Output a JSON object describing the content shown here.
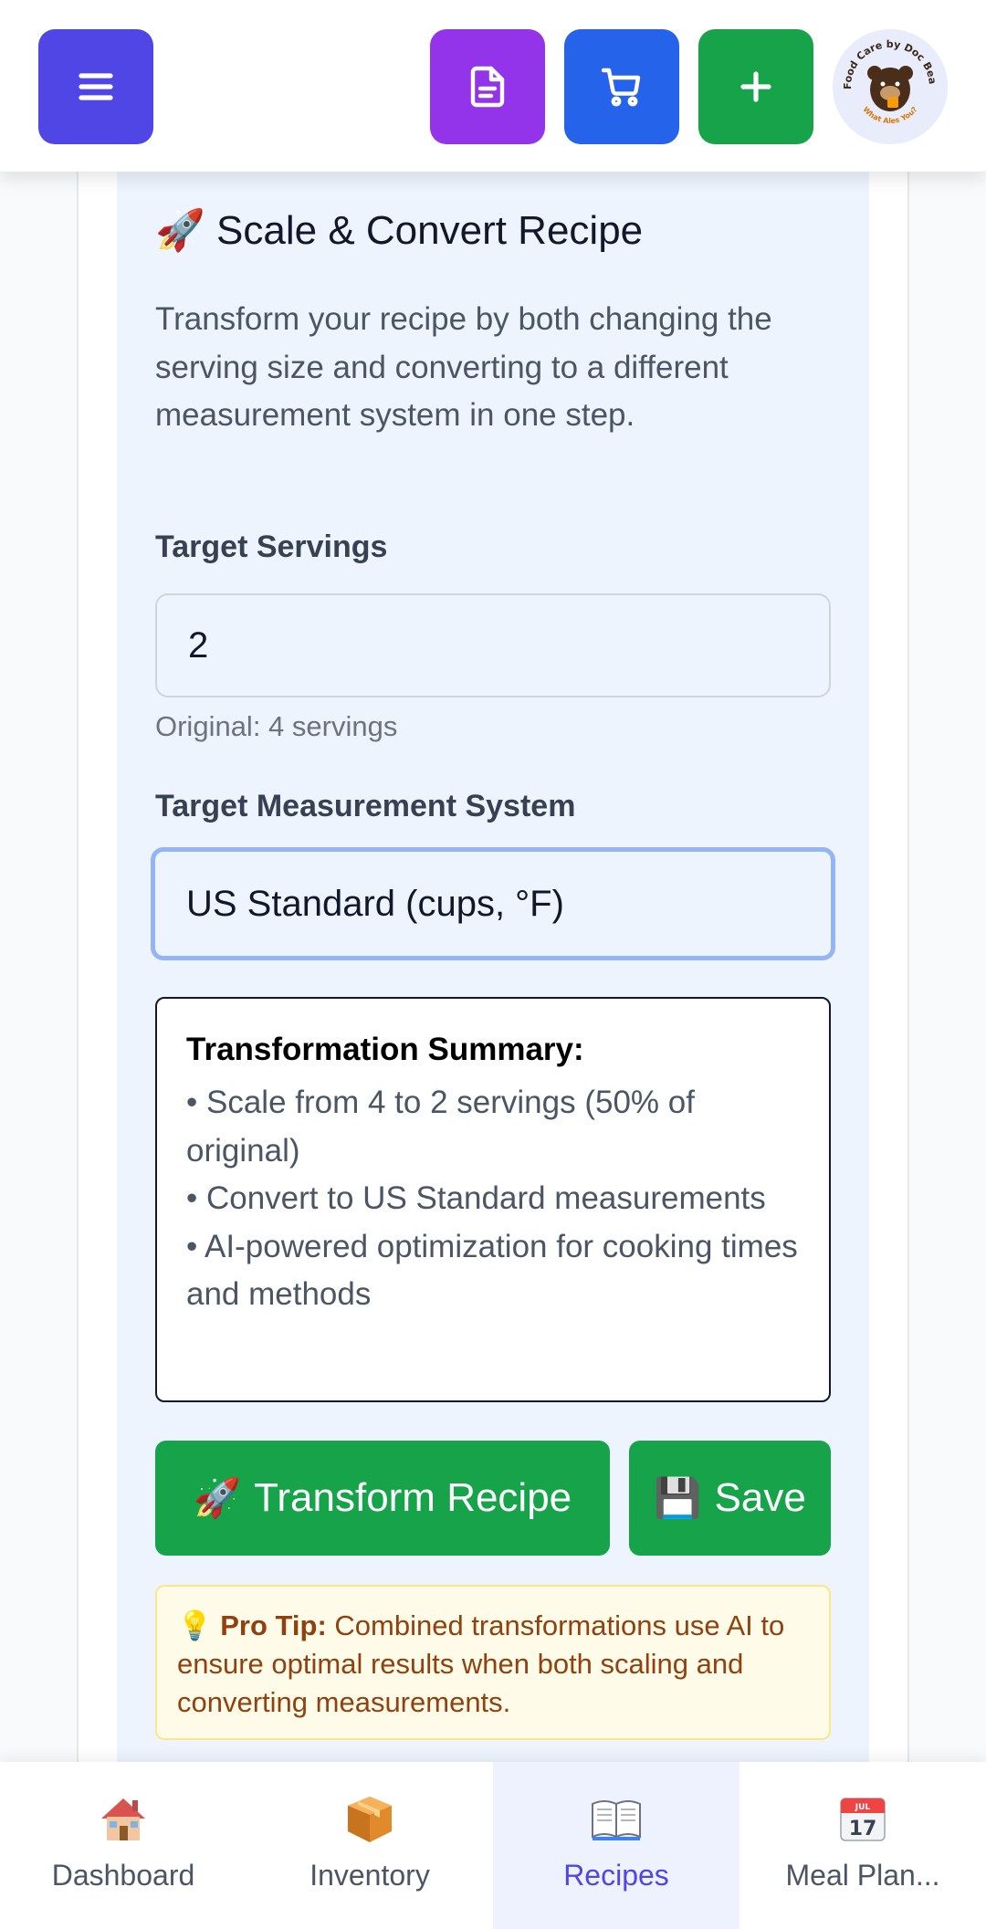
{
  "header": {
    "menu_icon": "hamburger-icon",
    "buttons": [
      {
        "name": "document",
        "icon": "document-icon",
        "color": "#9333ea"
      },
      {
        "name": "cart",
        "icon": "cart-icon",
        "color": "#2563eb"
      },
      {
        "name": "add",
        "icon": "plus-icon",
        "color": "#16a34a"
      }
    ],
    "logo_text_top": "Food Care by Doc Bear",
    "logo_text_bottom": "What Ales You?"
  },
  "section": {
    "title_emoji": "🚀",
    "title": "Scale & Convert Recipe",
    "description": "Transform your recipe by both changing the serving size and converting to a different measurement system in one step."
  },
  "form": {
    "servings_label": "Target Servings",
    "servings_value": "2",
    "servings_hint": "Original: 4 servings",
    "system_label": "Target Measurement System",
    "system_value": "US Standard (cups, °F)"
  },
  "summary": {
    "title": "Transformation Summary:",
    "items": [
      "• Scale from 4 to 2 servings (50% of original)",
      "• Convert to US Standard measurements",
      "• AI-powered optimization for cooking times and methods"
    ]
  },
  "actions": {
    "transform_emoji": "🚀",
    "transform_label": "Transform Recipe",
    "save_emoji": "💾",
    "save_label": "Save"
  },
  "tip": {
    "emoji": "💡",
    "label": "Pro Tip:",
    "text": "Combined transformations use AI to ensure optimal results when both scaling and converting measurements."
  },
  "bottom_nav": [
    {
      "label": "Dashboard",
      "icon": "house-icon",
      "active": false
    },
    {
      "label": "Inventory",
      "icon": "package-icon",
      "active": false
    },
    {
      "label": "Recipes",
      "icon": "open-book-icon",
      "active": true
    },
    {
      "label": "Meal Plan...",
      "icon": "calendar-icon",
      "active": false
    }
  ],
  "calendar_icon": {
    "month": "JUL",
    "day": "17"
  },
  "colors": {
    "accent": "#4f46e5",
    "green": "#16a34a",
    "panel_bg": "#eef4fe",
    "focus_border": "#93b4f5"
  }
}
